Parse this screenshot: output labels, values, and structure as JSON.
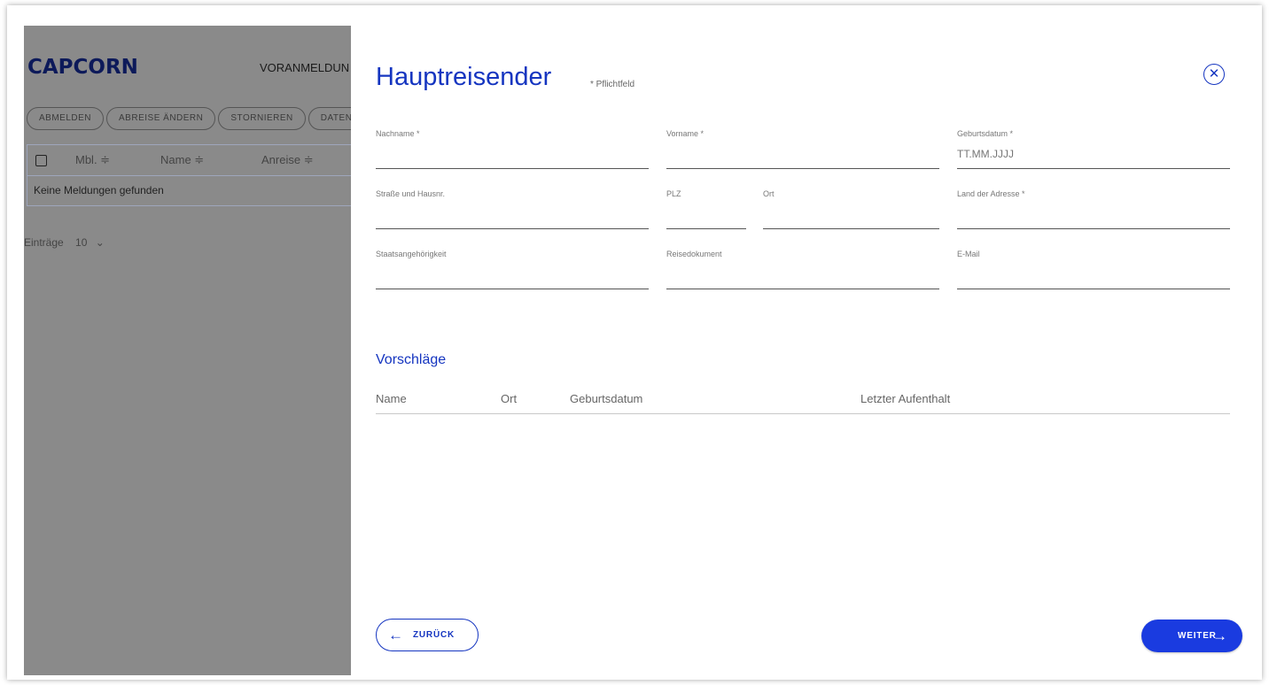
{
  "background_app": {
    "logo": "CAPCORN",
    "nav_item": "VORANMELDUN",
    "buttons": [
      "ABMELDEN",
      "ABREISE ÄNDERN",
      "STORNIEREN",
      "DATEN"
    ],
    "table_headers": [
      "Mbl. ≑",
      "Name ≑",
      "Anreise ≑"
    ],
    "empty_message": "Keine Meldungen gefunden",
    "entries_label": "Einträge",
    "entries_value": "10"
  },
  "modal": {
    "title": "Hauptreisender",
    "required_note": "* Pflichtfeld",
    "close_symbol": "✕",
    "fields": {
      "nachname": {
        "label": "Nachname *",
        "value": ""
      },
      "vorname": {
        "label": "Vorname *",
        "value": ""
      },
      "geburtsdatum": {
        "label": "Geburtsdatum *",
        "placeholder": "TT.MM.JJJJ"
      },
      "strasse": {
        "label": "Straße und Hausnr.",
        "value": ""
      },
      "plz": {
        "label": "PLZ",
        "value": ""
      },
      "ort": {
        "label": "Ort",
        "value": ""
      },
      "land": {
        "label": "Land der Adresse *",
        "value": ""
      },
      "staatsangehoerigkeit": {
        "label": "Staatsangehörigkeit",
        "value": ""
      },
      "reisedokument": {
        "label": "Reisedokument",
        "value": ""
      },
      "email": {
        "label": "E-Mail",
        "value": ""
      }
    },
    "suggestions": {
      "title": "Vorschläge",
      "columns": [
        "Name",
        "Ort",
        "Geburtsdatum",
        "Letzter Aufenthalt"
      ]
    },
    "back_button": {
      "label": "ZURÜCK",
      "icon": "←"
    },
    "next_button": {
      "label": "WEITER",
      "icon": "→"
    }
  },
  "colors": {
    "accent": "#1535c0",
    "primary_button": "#1a3be0",
    "overlay": "#8a8a8a"
  }
}
